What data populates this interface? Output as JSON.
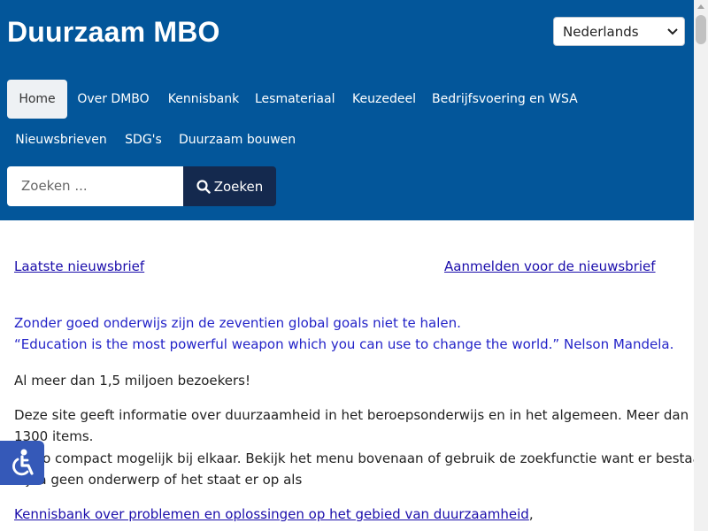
{
  "header": {
    "site_title": "Duurzaam MBO",
    "language": "Nederlands"
  },
  "nav": {
    "items": [
      {
        "label": "Home",
        "active": true
      },
      {
        "label": "Over DMBO"
      },
      {
        "label": "Kennisbank"
      },
      {
        "label": "Lesmateriaal"
      },
      {
        "label": "Keuzedeel"
      },
      {
        "label": "Bedrijfsvoering en WSA"
      },
      {
        "label": "Nieuwsbrieven"
      },
      {
        "label": "SDG's"
      },
      {
        "label": "Duurzaam bouwen"
      }
    ]
  },
  "search": {
    "placeholder": "Zoeken ...",
    "button_label": "Zoeken"
  },
  "main": {
    "link_latest_newsletter": "Laatste nieuwsbrief",
    "link_subscribe": "Aanmelden voor de nieuwsbrief",
    "quote_line1": "Zonder goed onderwijs zijn de zeventien global goals niet te halen.",
    "quote_line2": "“Education is the most powerful weapon which you can use to change the world.” Nelson Mandela.",
    "visitors": "Al meer dan 1,5 miljoen bezoekers!",
    "intro_line1": "Deze site geeft informatie over duurzaamheid in het beroepsonderwijs en in het algemeen. Meer dan",
    "intro_line2": "1300 items.",
    "intro_line3": "Zo zo compact mogelijk bij elkaar. Bekijk het menu bovenaan of gebruik de zoekfunctie want er bestaat",
    "intro_line4": "bijna geen onderwerp of het staat er op als",
    "kennisbank_link": "Kennisbank over problemen en oplossingen op het gebied van duurzaamheid",
    "kennisbank_suffix": ","
  },
  "colors": {
    "header_bg": "#03569a",
    "search_button_bg": "#14294e",
    "accessibility_bg": "#3559b8"
  },
  "icons": [
    "chevron-down-icon",
    "search-icon",
    "accessibility-icon",
    "scroll-up-arrow-icon"
  ]
}
